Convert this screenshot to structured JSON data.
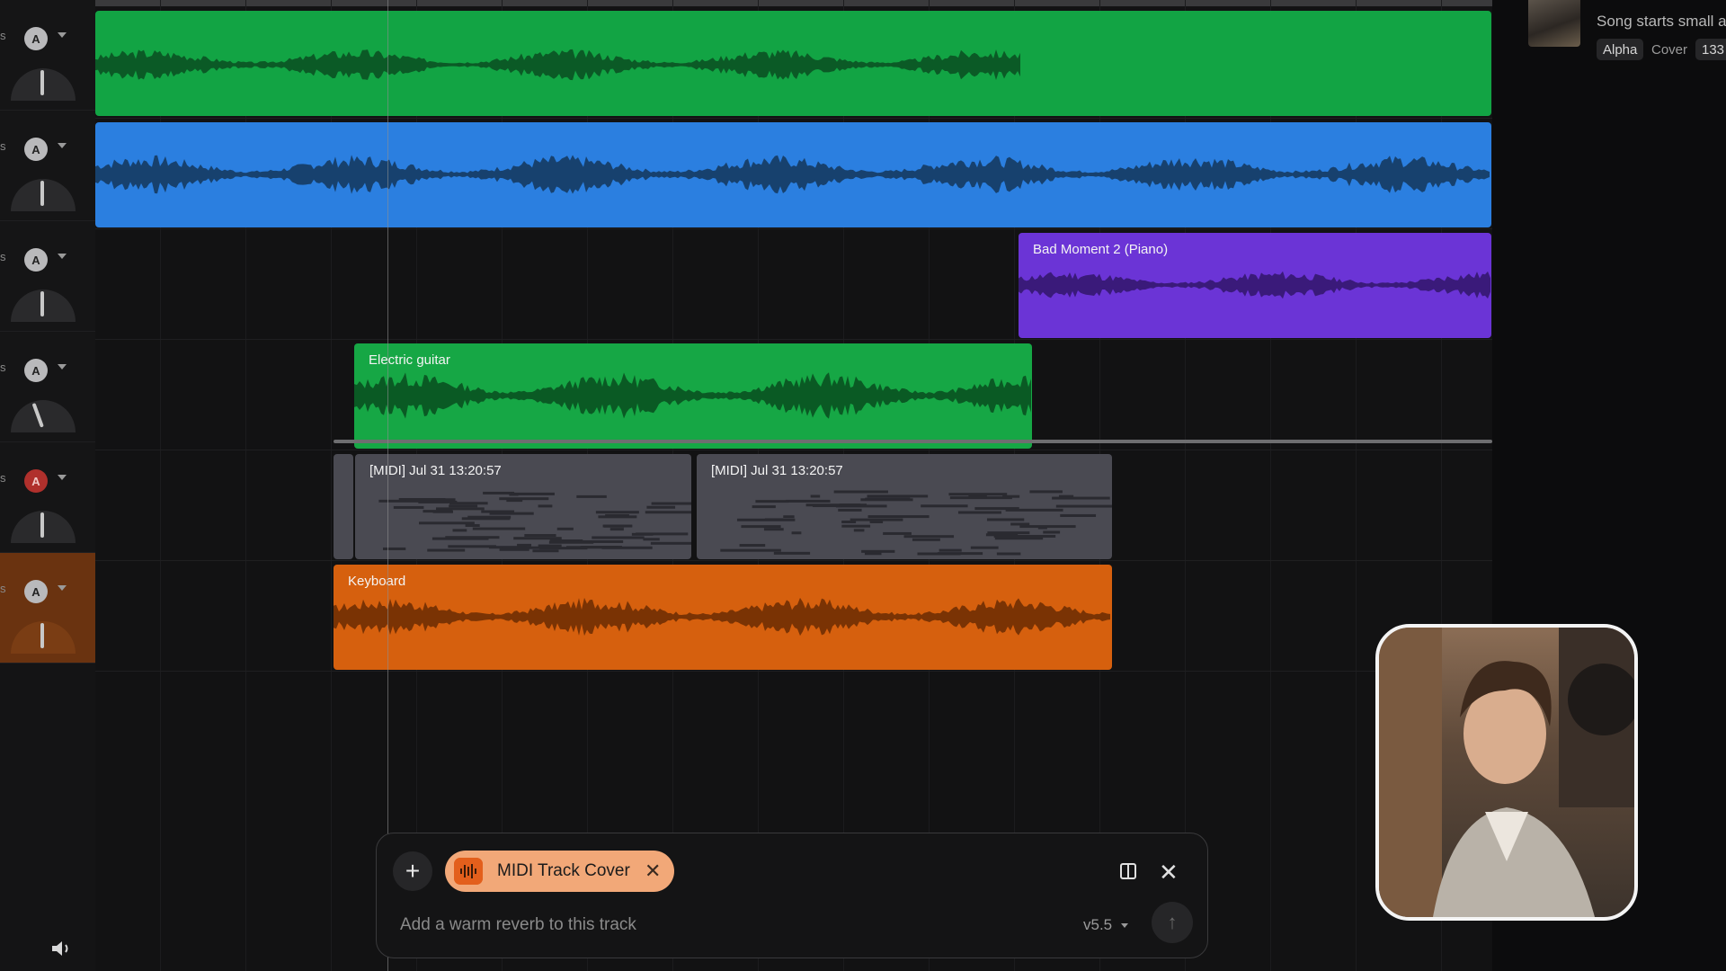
{
  "tracks": [
    {
      "letter": "A",
      "edge": "s",
      "clip_label": "",
      "color": "#12a444"
    },
    {
      "letter": "A",
      "edge": "s",
      "clip_label": "",
      "color": "#2b7fe0"
    },
    {
      "letter": "A",
      "edge": "s",
      "clip_label": "Bad Moment 2 (Piano)",
      "color": "#6b34d6"
    },
    {
      "letter": "A",
      "edge": "s",
      "clip_label": "Electric guitar",
      "color": "#16a745"
    },
    {
      "letter": "A",
      "edge": "s",
      "clip_label": "[MIDI] Jul 31 13:20:57",
      "color": "#4a4a52"
    },
    {
      "letter": "A",
      "edge": "s",
      "clip_label": "Keyboard",
      "color": "#d6600e"
    }
  ],
  "midi_clips": [
    "[MIDI] Jul 31 13:20:57",
    "[MIDI] Jul 31 13:20:57"
  ],
  "right_panel": {
    "song_description": "Song starts small ar",
    "tags": [
      "Alpha",
      "Cover",
      "133"
    ]
  },
  "prompt_bar": {
    "chip_label": "MIDI Track Cover",
    "input_placeholder": "Add a warm reverb to this track",
    "version": "v5.5",
    "plus_symbol": "+",
    "close_symbol": "✕",
    "chip_close_symbol": "✕",
    "send_symbol": "↑"
  },
  "icons": {
    "speaker": "speaker-icon",
    "panel": "panel-toggle-icon",
    "waveform": "waveform-icon"
  }
}
